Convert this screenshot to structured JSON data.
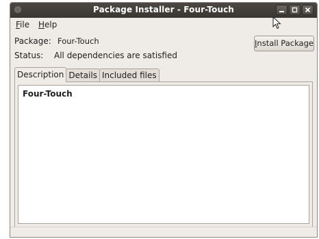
{
  "window": {
    "title": "Package Installer -  Four-Touch"
  },
  "menubar": {
    "file": {
      "mnemonic": "F",
      "rest": "ile"
    },
    "help": {
      "mnemonic": "H",
      "rest": "elp"
    }
  },
  "info": {
    "package_label": "Package:",
    "package_value": "Four-Touch",
    "status_label": "Status:",
    "status_value": "All dependencies are satisfied"
  },
  "install_button": {
    "mnemonic": "I",
    "rest": "nstall Package"
  },
  "tabs": [
    {
      "label": "Description",
      "active": true
    },
    {
      "label": "Details",
      "active": false
    },
    {
      "label": "Included files",
      "active": false
    }
  ],
  "description": {
    "text": "Four-Touch"
  },
  "icons": {
    "minimize": "minimize-icon",
    "maximize": "maximize-icon",
    "close": "close-icon",
    "cursor": "mouse-pointer-icon"
  }
}
